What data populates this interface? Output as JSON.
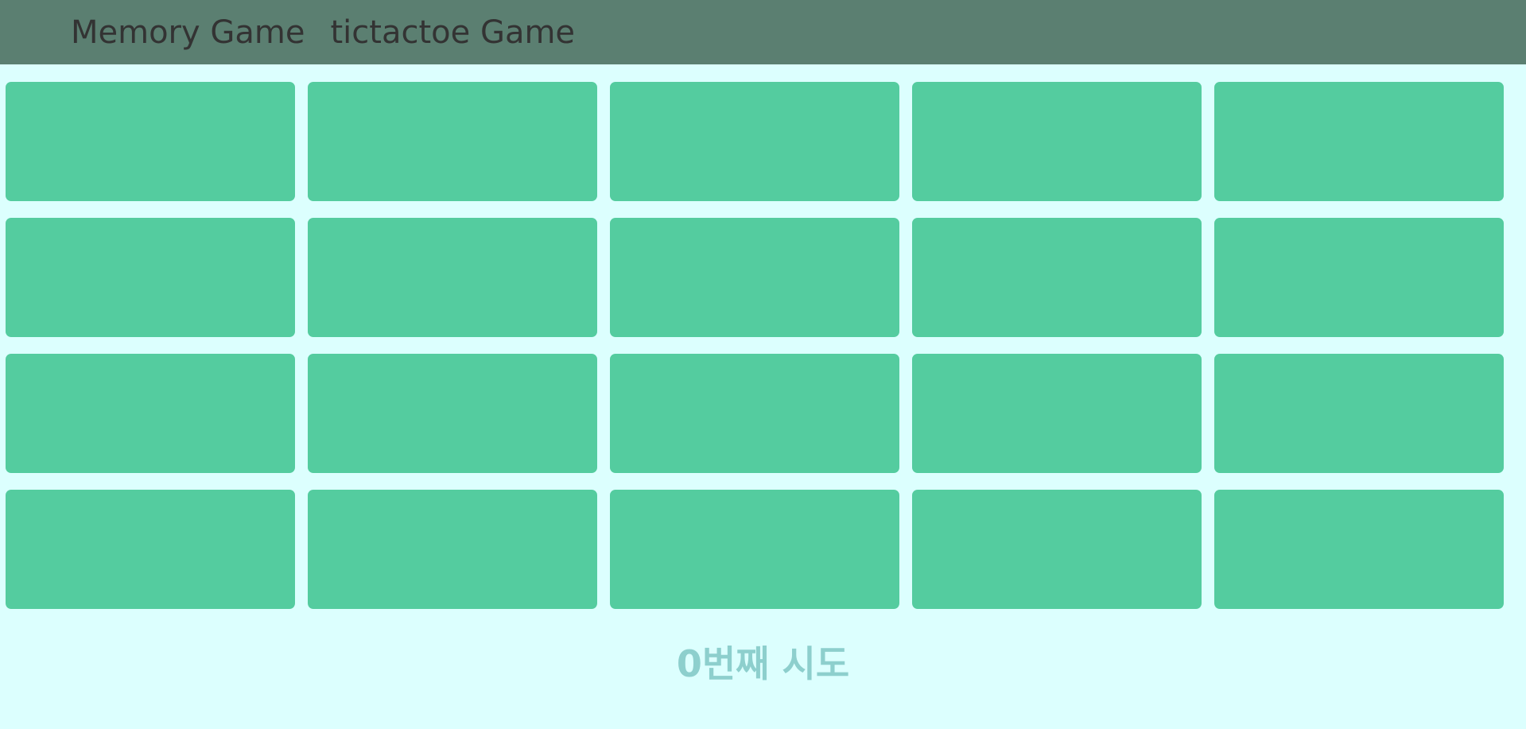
{
  "nav": {
    "links": [
      {
        "label": "Memory Game"
      },
      {
        "label": "tictactoe Game"
      }
    ]
  },
  "board": {
    "rows": 4,
    "columns": 5,
    "card_state": "face-down"
  },
  "status": {
    "tries": "0번째 시도"
  },
  "colors": {
    "nav_bg": "#5b7f71",
    "page_bg": "#dcfffe",
    "card": "#54cc9f",
    "tries_text": "#8dcfcd"
  }
}
